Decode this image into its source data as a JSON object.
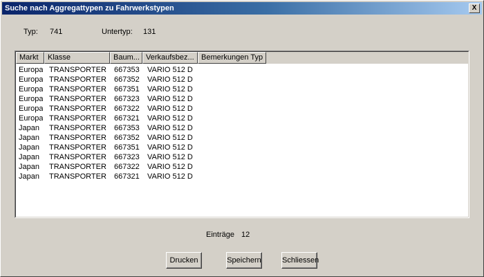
{
  "window": {
    "title": "Suche nach Aggregattypen zu Fahrwerkstypen",
    "close_glyph": "X"
  },
  "info": {
    "typ_label": "Typ:",
    "typ_value": "741",
    "untertyp_label": "Untertyp:",
    "untertyp_value": "131"
  },
  "table": {
    "columns": [
      "Markt",
      "Klasse",
      "Baum...",
      "Verkaufsbez...",
      "Bemerkungen Typ"
    ],
    "rows": [
      [
        "Europa",
        "TRANSPORTER",
        "667353",
        "VARIO  512 D",
        ""
      ],
      [
        "Europa",
        "TRANSPORTER",
        "667352",
        "VARIO  512 D",
        ""
      ],
      [
        "Europa",
        "TRANSPORTER",
        "667351",
        "VARIO  512 D",
        ""
      ],
      [
        "Europa",
        "TRANSPORTER",
        "667323",
        "VARIO  512 D",
        ""
      ],
      [
        "Europa",
        "TRANSPORTER",
        "667322",
        "VARIO  512 D",
        ""
      ],
      [
        "Europa",
        "TRANSPORTER",
        "667321",
        "VARIO  512 D",
        ""
      ],
      [
        "Japan",
        "TRANSPORTER",
        "667353",
        "VARIO  512 D",
        ""
      ],
      [
        "Japan",
        "TRANSPORTER",
        "667352",
        "VARIO  512 D",
        ""
      ],
      [
        "Japan",
        "TRANSPORTER",
        "667351",
        "VARIO  512 D",
        ""
      ],
      [
        "Japan",
        "TRANSPORTER",
        "667323",
        "VARIO  512 D",
        ""
      ],
      [
        "Japan",
        "TRANSPORTER",
        "667322",
        "VARIO  512 D",
        ""
      ],
      [
        "Japan",
        "TRANSPORTER",
        "667321",
        "VARIO  512 D",
        ""
      ]
    ]
  },
  "footer": {
    "eintraege_label": "Einträge",
    "eintraege_value": "12"
  },
  "buttons": {
    "drucken": "Drucken",
    "speichern": "Speichern",
    "schliessen": "Schliessen"
  }
}
